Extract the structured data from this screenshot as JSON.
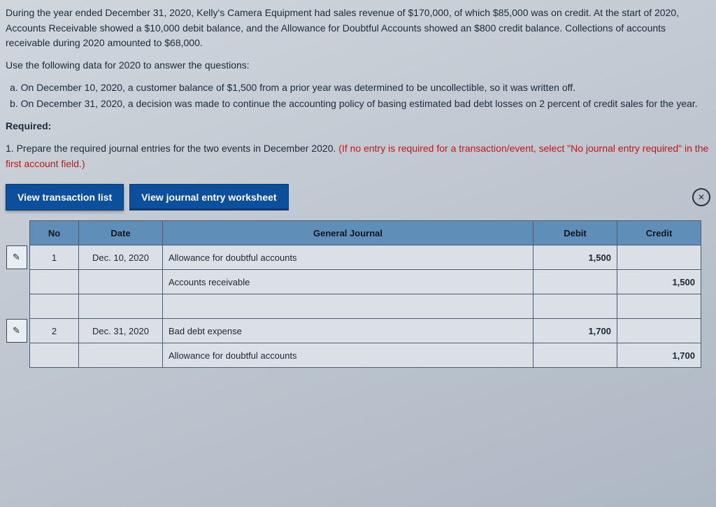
{
  "problem": {
    "p1": "During the year ended December 31, 2020, Kelly's Camera Equipment had sales revenue of $170,000, of which $85,000 was on credit. At the start of 2020, Accounts Receivable showed a $10,000 debit balance, and the Allowance for Doubtful Accounts showed an $800 credit balance. Collections of accounts receivable during 2020 amounted to $68,000.",
    "p2": "Use the following data for 2020 to answer the questions:",
    "item_a": "a. On December 10, 2020, a customer balance of $1,500 from a prior year was determined to be uncollectible, so it was written off.",
    "item_b": "b. On December 31, 2020, a decision was made to continue the accounting policy of basing estimated bad debt losses on 2 percent of credit sales for the year.",
    "required_label": "Required:",
    "req1_lead": "1. Prepare the required journal entries for the two events in December 2020. ",
    "req1_note": "(If no entry is required for a transaction/event, select \"No journal entry required\" in the first account field.)"
  },
  "tabs": {
    "transaction_list": "View transaction list",
    "journal_worksheet": "View journal entry worksheet"
  },
  "icons": {
    "close": "✕",
    "pencil": "✎"
  },
  "headers": {
    "no": "No",
    "date": "Date",
    "general_journal": "General Journal",
    "debit": "Debit",
    "credit": "Credit"
  },
  "entries": [
    {
      "no": "1",
      "date": "Dec. 10, 2020",
      "account1": "Allowance for doubtful accounts",
      "debit1": "1,500",
      "account2": "Accounts receivable",
      "credit2": "1,500"
    },
    {
      "no": "2",
      "date": "Dec. 31, 2020",
      "account1": "Bad debt expense",
      "debit1": "1,700",
      "account2": "Allowance for doubtful accounts",
      "credit2": "1,700"
    }
  ]
}
